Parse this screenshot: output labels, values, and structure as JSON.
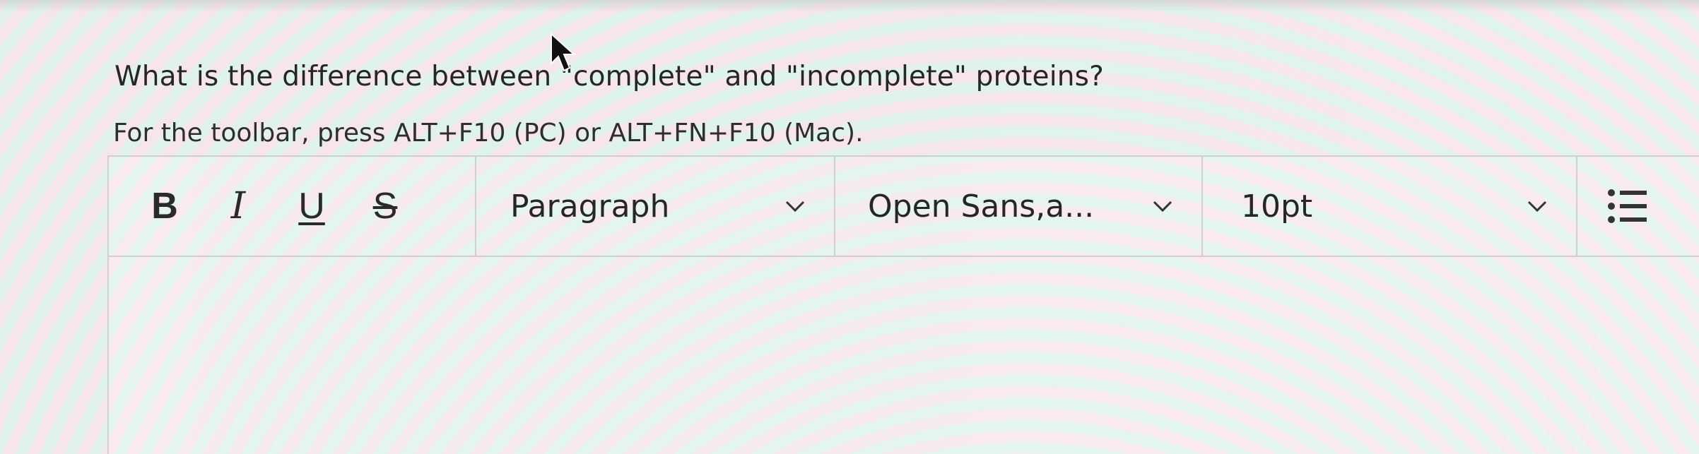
{
  "question": {
    "text": "What is the difference between \"complete\" and \"incomplete\" proteins?"
  },
  "hint": {
    "text": "For the toolbar, press ALT+F10 (PC) or ALT+FN+F10 (Mac)."
  },
  "toolbar": {
    "bold_label": "B",
    "italic_label": "I",
    "underline_label": "U",
    "strike_label": "S",
    "block_format": {
      "selected": "Paragraph"
    },
    "font_family": {
      "selected": "Open Sans,a..."
    },
    "font_size": {
      "selected": "10pt"
    },
    "list_icon": "bullet-list-icon"
  },
  "editor": {
    "content": ""
  },
  "colors": {
    "text": "#262626",
    "border": "#cfcfcf"
  }
}
